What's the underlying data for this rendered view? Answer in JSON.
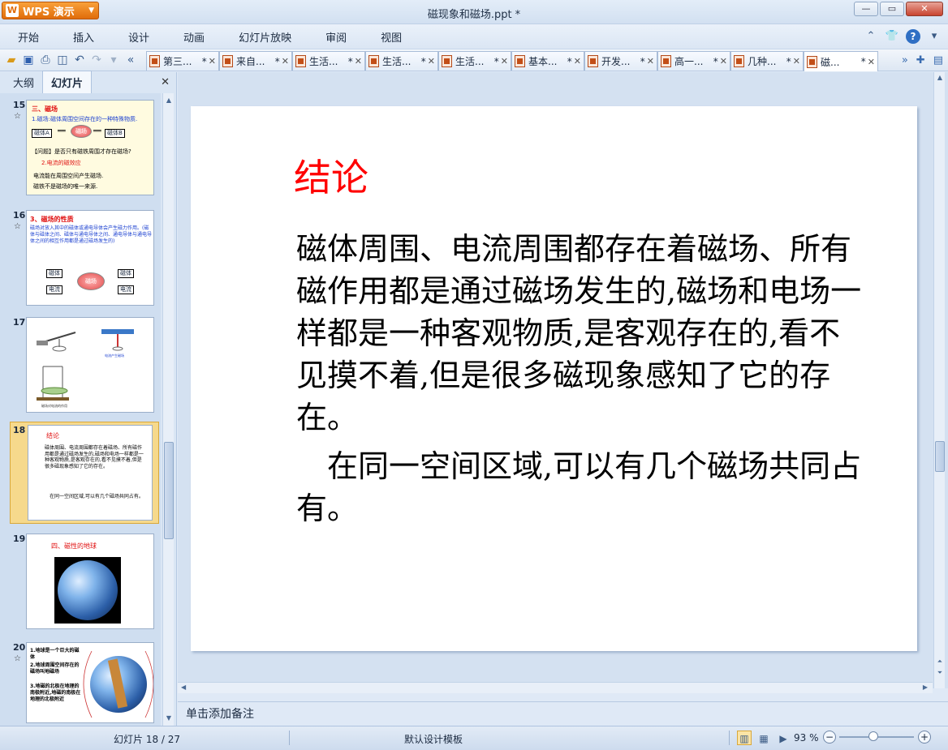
{
  "app": {
    "name": "WPS 演示",
    "logo_glyph": "W",
    "document_title": "磁现象和磁场.ppt *"
  },
  "menu": [
    "开始",
    "插入",
    "设计",
    "动画",
    "幻灯片放映",
    "审阅",
    "视图"
  ],
  "tabs": [
    {
      "label": "第三...",
      "mod": "*"
    },
    {
      "label": "来自...",
      "mod": "*"
    },
    {
      "label": "生活...",
      "mod": "*"
    },
    {
      "label": "生活...",
      "mod": "*"
    },
    {
      "label": "生活...",
      "mod": "*"
    },
    {
      "label": "基本...",
      "mod": "*"
    },
    {
      "label": "开发...",
      "mod": "*"
    },
    {
      "label": "高一...",
      "mod": "*"
    },
    {
      "label": "几种...",
      "mod": "*"
    },
    {
      "label": "磁...",
      "mod": "*"
    }
  ],
  "left_panel": {
    "tab_outline": "大纲",
    "tab_slides": "幻灯片",
    "close_glyph": "✕"
  },
  "thumbnails": {
    "s15": {
      "num": "15",
      "heading": "三、磁场",
      "line1": "1.磁场:磁体周围空间存在的一种特殊物质.",
      "box_a": "磁体A",
      "circle": "磁场",
      "box_b": "磁体B",
      "question": "【问题】是否只有磁铁周围才存在磁场?",
      "item2": "2.电流的磁效应",
      "line3": "电流能在周围空间产生磁场.",
      "line4": "磁铁不是磁场的唯一来源."
    },
    "s16": {
      "num": "16",
      "heading": "3、磁场的性质",
      "body": "磁场对放入其中的磁体或通电导体会产生磁力作用。(磁体与磁体之间、磁体与通电导体之间、通电导体与通电导体之间的相互作用都是通过磁场发生的)",
      "b1": "磁体",
      "b2": "磁体",
      "b3": "电流",
      "b4": "电流",
      "center": "磁场"
    },
    "s17": {
      "num": "17"
    },
    "s18": {
      "num": "18",
      "title": "结论",
      "body": "磁体周围、电流周围都存在着磁场、所有磁作用都是通过磁场发生的,磁场和电场一样都是一种客观物质,是客观存在的,看不见摸不着,但是很多磁现象感知了它的存在。",
      "p2": "在同一空间区域,可以有几个磁场共同占有。"
    },
    "s19": {
      "num": "19",
      "title": "四、磁性的地球"
    },
    "s20": {
      "num": "20",
      "l1": "1.地球是一个巨大的磁体",
      "l2": "2.地球周围空间存在的磁场叫地磁场",
      "l3": "3.地磁的北极在地理的南极附近,地磁的南极在地理的北极附近"
    }
  },
  "slide": {
    "title": "结论",
    "p1": "磁体周围、电流周围都存在着磁场、所有磁作用都是通过磁场发生的,磁场和电场一样都是一种客观物质,是客观存在的,看不见摸不着,但是很多磁现象感知了它的存在。",
    "p2": "在同一空间区域,可以有几个磁场共同占有。"
  },
  "notes_placeholder": "单击添加备注",
  "status": {
    "slide_counter": "幻灯片 18 / 27",
    "template": "默认设计模板",
    "zoom": "93 %"
  },
  "colors": {
    "title_red": "#ff0000",
    "selection": "#f6d98c",
    "accent_blue": "#1a3fd0"
  }
}
